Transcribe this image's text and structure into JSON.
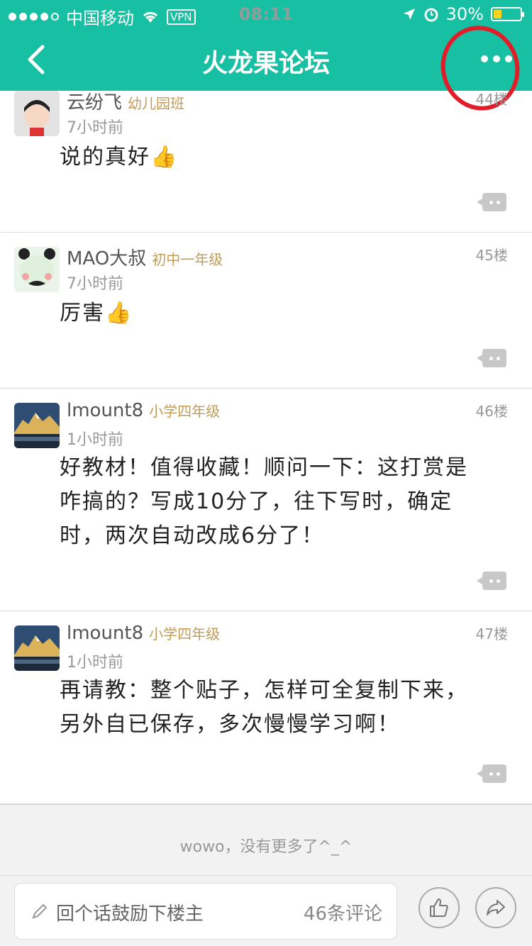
{
  "status_bar": {
    "carrier": "中国移动",
    "vpn": "VPN",
    "time": "08:11",
    "battery": "30%"
  },
  "nav": {
    "title": "火龙果论坛"
  },
  "posts": [
    {
      "name": "云纷飞",
      "grade": "幼儿园班",
      "time": "7小时前",
      "floor": "44楼",
      "content": "说的真好👍"
    },
    {
      "name": "MAO大叔",
      "grade": "初中一年级",
      "time": "7小时前",
      "floor": "45楼",
      "content": "厉害👍"
    },
    {
      "name": "lmount8",
      "grade": "小学四年级",
      "time": "1小时前",
      "floor": "46楼",
      "content": "好教材！值得收藏！顺问一下：这打赏是咋搞的？写成10分了，往下写时，确定时，两次自动改成6分了！"
    },
    {
      "name": "lmount8",
      "grade": "小学四年级",
      "time": "1小时前",
      "floor": "47楼",
      "content": "再请教：整个贴子，怎样可全复制下来，另外自已保存，多次慢慢学习啊！"
    }
  ],
  "end_text": "wowo，没有更多了^_^",
  "bottom": {
    "placeholder": "回个话鼓励下楼主",
    "comment_count": "46条评论"
  },
  "colors": {
    "primary": "#17bfa3",
    "grade": "#c49b54",
    "annotation": "#e21d2a"
  }
}
